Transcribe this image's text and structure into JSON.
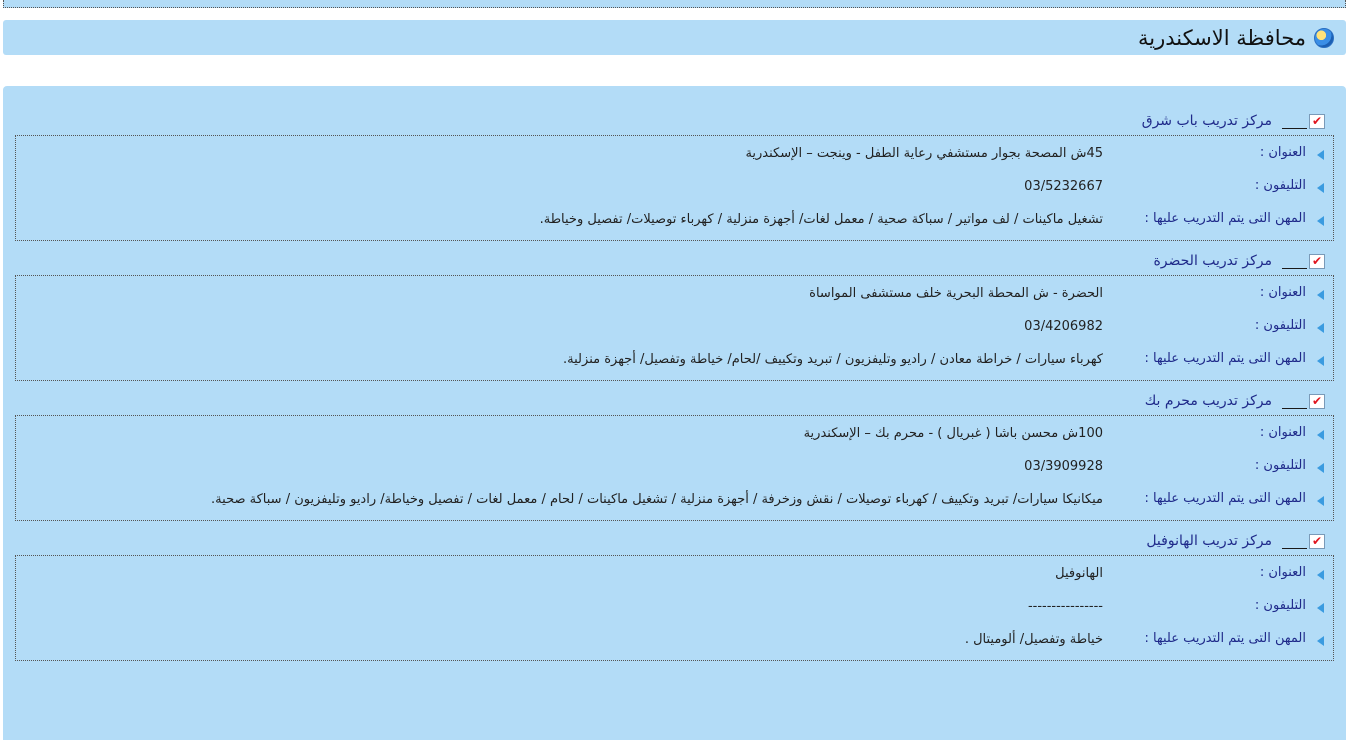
{
  "governorate": {
    "title": "محافظة الاسكندرية"
  },
  "labels": {
    "address": "العنوان :",
    "phone": "التليفون :",
    "trades": "المهن التى يتم التدريب عليها :"
  },
  "centers": [
    {
      "name": "مركز تدريب باب شرق",
      "address": "45ش المصحة بجوار مستشفي رعاية الطفل - وينجت – الإسكندرية",
      "phone": "03/5232667",
      "trades": "تشغيل ماكينات / لف مواتير / سباكة صحية / معمل لغات/ أجهزة منزلية / كهرباء     توصيلات/ تفصيل وخياطة."
    },
    {
      "name": "مركز تدريب الحضرة",
      "address": "الحضرة - ش المحطة البحرية خلف مستشفى المواساة",
      "phone": "03/4206982",
      "trades": "كهرباء سيارات / خراطة معادن / راديو وتليفزيون / تبريد وتكييف /لحام/ خياطة وتفصيل/ أجهزة منزلية."
    },
    {
      "name": "مركز تدريب محرم بك",
      "address": "100ش محسن باشا ( غبريال ) - محرم بك – الإسكندرية",
      "phone": "03/3909928",
      "trades": "ميكانيكا سيارات/ تبريد وتكييف / كهرباء     توصيلات / نقش وزخرفة / أجهزة منزلية / تشغيل ماكينات / لحام / معمل لغات / تفصيل وخياطة/ راديو وتليفزيون / سباكة صحية."
    },
    {
      "name": "مركز تدريب الهانوفيل",
      "address": "الهانوفيل",
      "phone": "----------------",
      "trades": "خياطة وتفصيل/ ألوميتال ."
    }
  ],
  "icons": {
    "header": "globe-icon",
    "center": "checkbox-icon",
    "row": "arrow-left-icon"
  },
  "colors": {
    "panel": "#b3dcf7",
    "label": "#1f2a8a",
    "check": "#e0141e",
    "arrow": "#3a9be0"
  }
}
